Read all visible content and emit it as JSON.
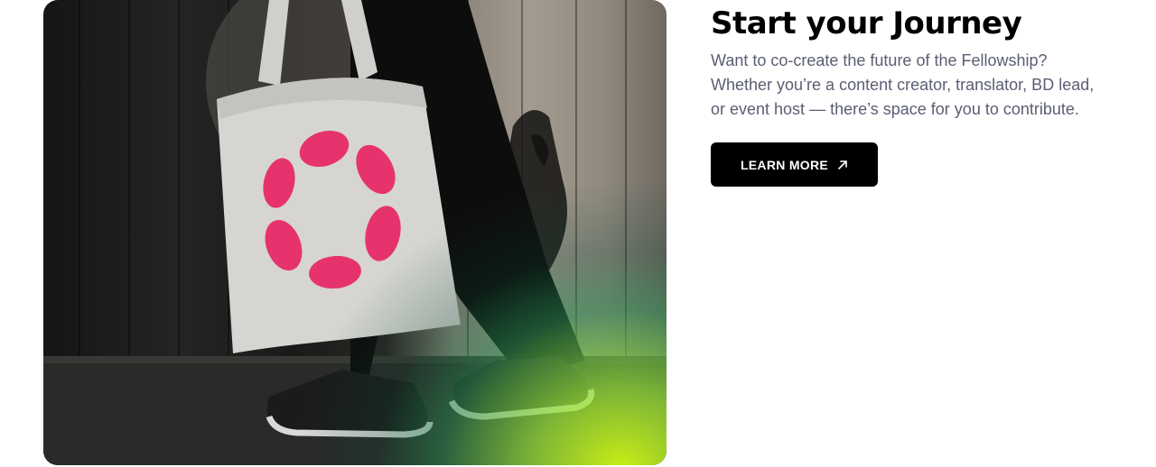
{
  "section": {
    "title": "Start your Journey",
    "description": "Want to co-create the future of the Fellowship? Whether you’re a content creator, translator, BD lead, or event host — there’s space for you to contribute.",
    "cta_label": "LEARN MORE",
    "cta_icon": "arrow-up-right-icon"
  },
  "image": {
    "subject": "tote-bag-photo",
    "logo_color": "#e6336e",
    "accent_gradient": "#d6ff14"
  }
}
